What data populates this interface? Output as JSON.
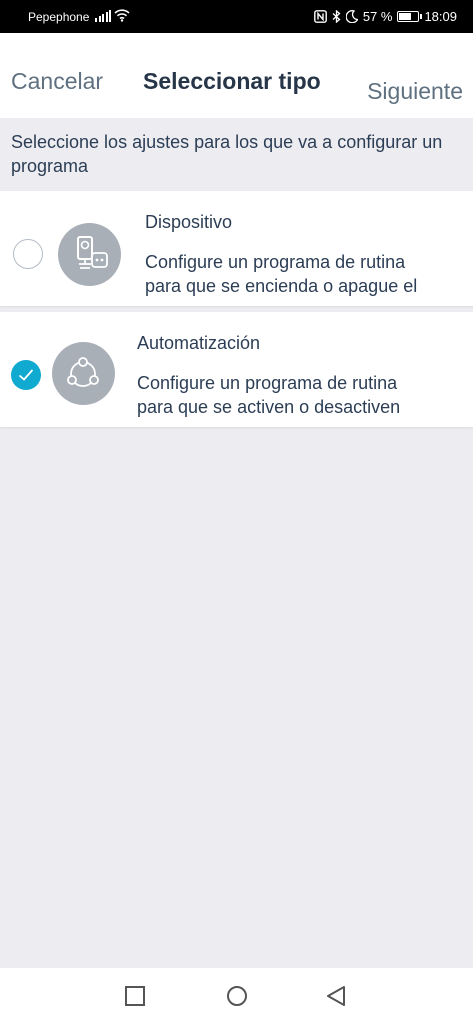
{
  "status_bar": {
    "carrier": "Pepephone",
    "battery_percent": "57 %",
    "time": "18:09",
    "icons": [
      "signal-icon",
      "wifi-icon",
      "nfc-icon",
      "bluetooth-icon",
      "do-not-disturb-moon-icon",
      "battery-icon"
    ]
  },
  "header": {
    "cancel_label": "Cancelar",
    "title": "Seleccionar tipo",
    "next_label": "Siguiente"
  },
  "instructions": "Seleccione los ajustes para los que va a configurar un programa",
  "options": [
    {
      "title": "Dispositivo",
      "description_line1": "Configure un programa de rutina",
      "description_line2": "para que se encienda o apague el",
      "selected": false,
      "icon": "device-plug-icon"
    },
    {
      "title": "Automatización",
      "description_line1": "Configure un programa de rutina",
      "description_line2": "para que se activen o desactiven",
      "selected": true,
      "icon": "automation-nodes-icon"
    }
  ],
  "colors": {
    "accent": "#10a9cf",
    "text_dark": "#263547",
    "text_muted": "#5f7180",
    "background": "#ececf1",
    "icon_bg": "#a9afb7"
  },
  "nav_bar": {
    "buttons": [
      "recent-apps-icon",
      "home-icon",
      "back-icon"
    ]
  }
}
